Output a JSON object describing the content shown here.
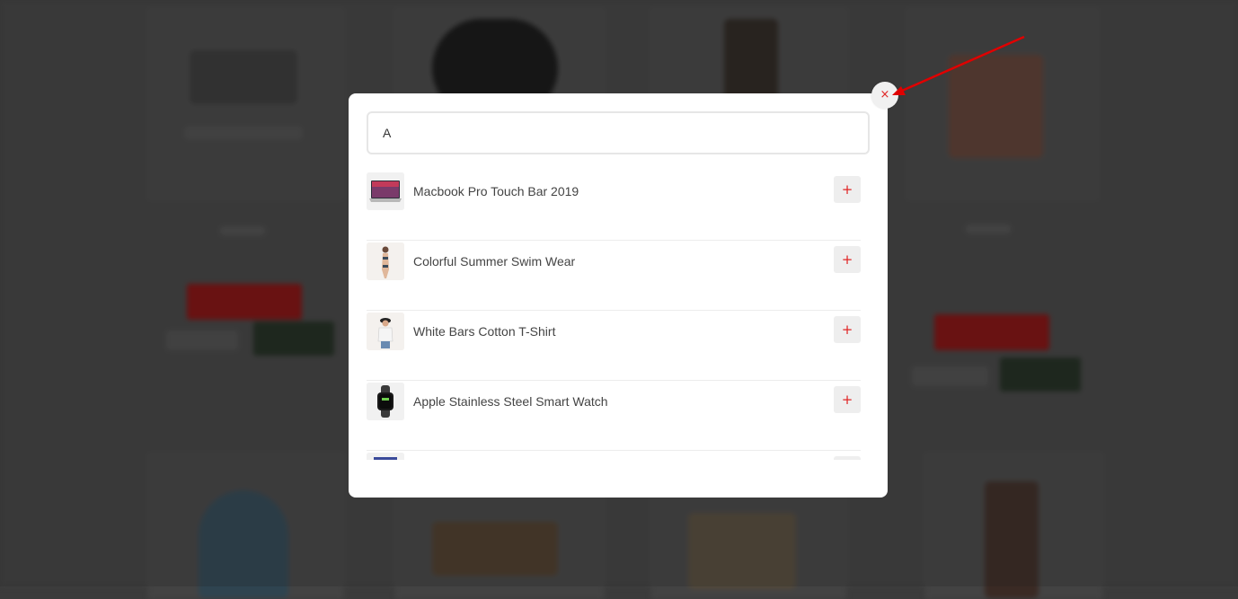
{
  "search": {
    "value": "A",
    "placeholder": ""
  },
  "results": [
    {
      "name": "Macbook Pro Touch Bar 2019",
      "icon": "laptop-thumbnail",
      "add_label": "+"
    },
    {
      "name": "Colorful Summer Swim Wear",
      "icon": "swimwear-thumbnail",
      "add_label": "+"
    },
    {
      "name": "White Bars Cotton T-Shirt",
      "icon": "tshirt-thumbnail",
      "add_label": "+"
    },
    {
      "name": "Apple Stainless Steel Smart Watch",
      "icon": "smartwatch-thumbnail",
      "add_label": "+"
    },
    {
      "name": "",
      "icon": "product-thumbnail",
      "add_label": "+"
    }
  ],
  "close": {
    "label": "×",
    "icon": "close-icon"
  },
  "colors": {
    "accent": "#e02424",
    "annotation_arrow": "#e00000",
    "backdrop": "#3b3b3b"
  }
}
